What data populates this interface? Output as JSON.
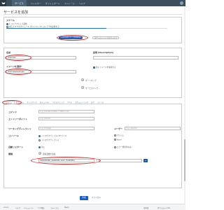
{
  "topbar": {
    "active_tab": "サービス",
    "nav": [
      "フィルター",
      "ダッシュボード",
      "ストレージ",
      "ヘルプ"
    ]
  },
  "heading": "サービスを追加",
  "scale": {
    "label": "スケール",
    "option1": "1 コンテナとして起動",
    "option2": "あとで 0 やスケジュール (サイドキック) コンテナを起動する",
    "size_selected": "containers 1 ~ container",
    "size_other": "スケール/ノードでのサービス",
    "slider_level": 0.62
  },
  "form": {
    "name_label": "名前",
    "name_value": "example",
    "desc_label": "説明 (Description)",
    "image_label": "イメージを選択*",
    "image_value": "example/example",
    "pull_label": "常にイメージを取得する",
    "ports_btn": "ポートマップ",
    "links_btn": "サービスリンク"
  },
  "tabs": [
    "コマンド",
    "ボリューム",
    "ネットワーク",
    "セキュリティ",
    "ヘルスチェック",
    "ラベル",
    "スケジューリング",
    "ログ",
    "リソース"
  ],
  "command": {
    "command_label": "コマンド",
    "command_ph": "e.g. /usr/sbin/httpd -f httpd.conf",
    "entry_label": "エントリーポイント",
    "entry_ph": "e.g. /bin/sh",
    "workdir_label": "ワーキングディレクトリ",
    "workdir_ph": "e.g. /myapp",
    "user_label": "ユーザー",
    "user_ph": "e.g. apache",
    "console_label": "コンソール",
    "console_opt1": "インタラクティブ & TTY (-i -t)",
    "console_opt2": "インタラクティブ (-i)",
    "console_opt3": "TTY (-t)",
    "console_opt4": "None",
    "autorestart_label": "自動リスタート",
    "autorestart_opt1": "常に",
    "autorestart_opt2": "エラー発生時のみ",
    "env_label": "環境",
    "env_add": "環境変数を追加",
    "env_key": "PASSWORD_RANDOM_SALT_HASH(BK)",
    "env_value": "="
  },
  "actions": {
    "create": "作成",
    "cancel": "キャンセル"
  },
  "footer": {
    "items": [
      "v1.x.x",
      "ヘルプ",
      "ドキュメント",
      "バグ報告",
      "フォーラム",
      "Slack"
    ],
    "right": "日本語",
    "download": "ダウンロードCLI"
  },
  "colors": {
    "topbar": "#3b4f5f",
    "primary": "#1a5fb4",
    "annotation": "#dd2222"
  }
}
